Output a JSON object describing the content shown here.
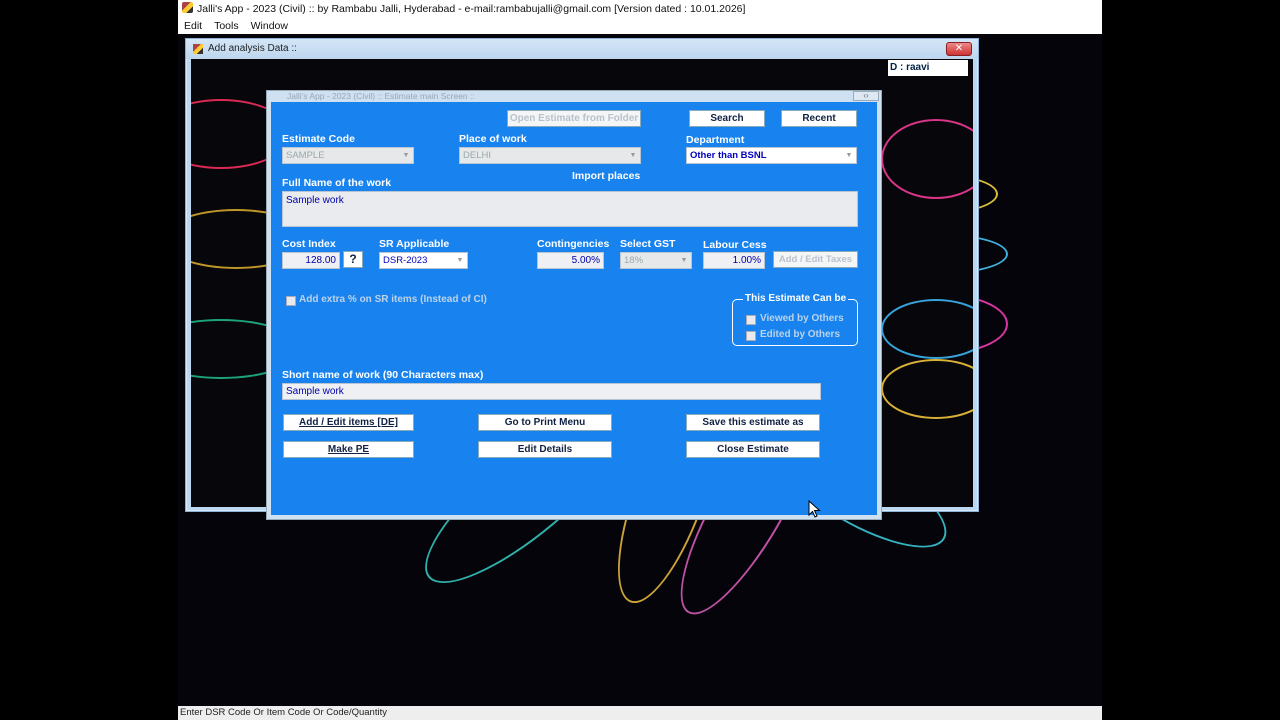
{
  "app": {
    "title": "Jalli's App - 2023 (Civil) ::  by Rambabu Jalli, Hyderabad - e-mail:rambabujalli@gmail.com [Version dated : 10.01.2026]",
    "menu": [
      "Edit",
      "Tools",
      "Window"
    ],
    "status": "Enter DSR Code Or Item Code Or Code/Quantity"
  },
  "analysis_dialog": {
    "title": "Add analysis Data ::",
    "close_symbol": "✕",
    "side_label": "D : raavi"
  },
  "estimate_window": {
    "title": "Jalli's App - 2023 (Civil) ::  Estimate main Screen ::",
    "minimize_symbol": "‹›",
    "buttons": {
      "open_from_folder": "Open Estimate from Folder",
      "search": "Search",
      "recent": "Recent",
      "add_edit_taxes": "Add / Edit Taxes",
      "add_edit_items": "Add / Edit items  [DE]",
      "print_menu": "Go to Print Menu",
      "save_as": "Save this estimate as",
      "make_pe": "Make PE",
      "edit_details": "Edit Details",
      "close_estimate": "Close Estimate",
      "help": "?"
    },
    "labels": {
      "estimate_code": "Estimate Code",
      "place_of_work": "Place of work",
      "department": "Department",
      "import_places": "Import places",
      "full_name": "Full Name of the work",
      "cost_index": "Cost Index",
      "sr_applicable": "SR Applicable",
      "contingencies": "Contingencies",
      "select_gst": "Select GST",
      "labour_cess": "Labour Cess",
      "extra_percent": "Add extra % on SR items (Instead of CI)",
      "estimate_can_be": "This Estimate Can be",
      "viewed_by_others": "Viewed by Others",
      "edited_by_others": "Edited by Others",
      "short_name": "Short name of work (90 Characters max)"
    },
    "values": {
      "estimate_code": "SAMPLE",
      "place_of_work": "DELHI",
      "department": "Other than BSNL",
      "full_name": "Sample work",
      "cost_index": "128.00",
      "sr_applicable": "DSR-2023",
      "contingencies": "5.00%",
      "gst": "18%",
      "labour_cess": "1.00%",
      "short_name": "Sample work"
    }
  }
}
